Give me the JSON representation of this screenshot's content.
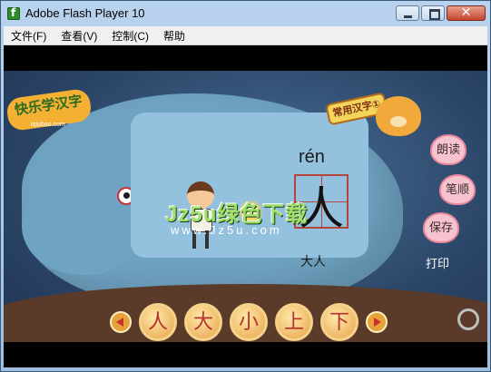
{
  "window": {
    "title": "Adobe Flash Player 10",
    "icon": "flash-player-icon",
    "controls": {
      "minimize": "minimize-icon",
      "maximize": "maximize-icon",
      "close": "✕"
    }
  },
  "menu": {
    "items": [
      {
        "label": "文件(F)"
      },
      {
        "label": "查看(V)"
      },
      {
        "label": "控制(C)"
      },
      {
        "label": "帮助"
      }
    ]
  },
  "content": {
    "logo": "快乐学汉字",
    "logo_sub": "iqiubao.com",
    "banner": "常用汉字①",
    "pinyin": "rén",
    "character": "人",
    "word": "大人",
    "watermark": "Jz5u绿色下载",
    "watermark_url": "www.Jz5u.com",
    "side_buttons": [
      {
        "label": "朗读"
      },
      {
        "label": "笔顺"
      },
      {
        "label": "保存"
      },
      {
        "label": "打印"
      }
    ],
    "characters": [
      {
        "label": "人"
      },
      {
        "label": "大"
      },
      {
        "label": "小"
      },
      {
        "label": "上"
      },
      {
        "label": "下"
      }
    ]
  },
  "colors": {
    "titlebar": "#b9d3ee",
    "scene_bg": "#2c4668",
    "elephant": "#6fa3c2",
    "board": "#93c1de",
    "button_gold": "#e6a34a",
    "heart_pink": "#f7c3cf"
  }
}
